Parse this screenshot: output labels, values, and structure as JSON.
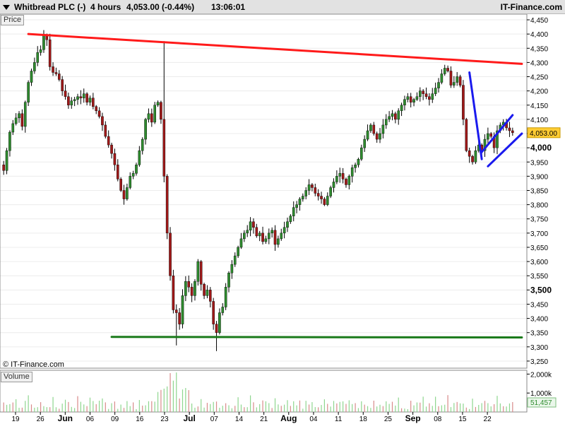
{
  "header": {
    "title": "Whitbread PLC (-)",
    "timeframe": "4 hours",
    "price_change": "4,053.00 (-0.44%)",
    "time": "13:06:01",
    "brand": "IT-Finance.com"
  },
  "panes": {
    "price_label": "Price",
    "volume_label": "Volume",
    "copyright": "© IT-Finance.com"
  },
  "colors": {
    "up_candle": "#2e8b2e",
    "down_candle": "#a01818",
    "resistance": "#ff1a1a",
    "support": "#1a7a1a",
    "channel": "#1a1aee",
    "volume_bar": "#8fd68f",
    "last_price_bg": "#ffcc33"
  },
  "chart_data": {
    "type": "candlestick",
    "title": "Whitbread PLC (-)",
    "interval": "4 hours",
    "last_price": 4053.0,
    "last_price_label": "4,053.00",
    "ylim": [
      3225,
      4470
    ],
    "y_ticks": [
      3250,
      3300,
      3350,
      3400,
      3450,
      3500,
      3550,
      3600,
      3650,
      3700,
      3750,
      3800,
      3850,
      3900,
      3950,
      4000,
      4050,
      4100,
      4150,
      4200,
      4250,
      4300,
      4350,
      4400,
      4450
    ],
    "y_tick_labels": [
      "3,250",
      "3,300",
      "3,350",
      "3,400",
      "3,450",
      "3,500",
      "3,550",
      "3,600",
      "3,650",
      "3,700",
      "3,750",
      "3,800",
      "3,850",
      "3,900",
      "3,950",
      "4,000",
      "4,050",
      "4,100",
      "4,150",
      "4,200",
      "4,250",
      "4,300",
      "4,350",
      "4,400",
      "4,450"
    ],
    "y_bold_labels": [
      "3,500",
      "4,000"
    ],
    "x_tick_labels": [
      "19",
      "26",
      "Jun",
      "06",
      "09",
      "16",
      "23",
      "Jul",
      "07",
      "14",
      "21",
      "Aug",
      "04",
      "11",
      "18",
      "25",
      "Sep",
      "08",
      "15",
      "22"
    ],
    "x_bold_labels": [
      "Jun",
      "Jul",
      "Aug",
      "Sep"
    ],
    "closes": [
      3920,
      3990,
      4055,
      4085,
      4105,
      4120,
      4075,
      4160,
      4230,
      4270,
      4300,
      4335,
      4345,
      4395,
      4380,
      4285,
      4265,
      4260,
      4240,
      4200,
      4180,
      4150,
      4165,
      4170,
      4180,
      4175,
      4190,
      4160,
      4175,
      4145,
      4130,
      4110,
      4080,
      4040,
      4010,
      3980,
      3940,
      3890,
      3850,
      3820,
      3860,
      3900,
      3910,
      3940,
      3990,
      4030,
      4100,
      4120,
      4090,
      4150,
      4160,
      4100,
      3900,
      3700,
      3550,
      3430,
      3420,
      3380,
      3480,
      3530,
      3510,
      3480,
      3530,
      3600,
      3520,
      3480,
      3500,
      3460,
      3380,
      3350,
      3420,
      3440,
      3510,
      3560,
      3590,
      3620,
      3650,
      3680,
      3700,
      3710,
      3740,
      3720,
      3690,
      3700,
      3670,
      3680,
      3700,
      3710,
      3660,
      3680,
      3700,
      3720,
      3740,
      3760,
      3790,
      3800,
      3820,
      3830,
      3850,
      3870,
      3860,
      3840,
      3830,
      3820,
      3800,
      3830,
      3860,
      3880,
      3900,
      3910,
      3890,
      3870,
      3900,
      3930,
      3940,
      3960,
      4000,
      4030,
      4060,
      4080,
      4050,
      4030,
      4050,
      4080,
      4100,
      4110,
      4120,
      4100,
      4130,
      4150,
      4170,
      4180,
      4160,
      4170,
      4180,
      4200,
      4190,
      4180,
      4170,
      4190,
      4210,
      4230,
      4260,
      4280,
      4270,
      4220,
      4230,
      4250,
      4220,
      4100,
      3990,
      3970,
      3950,
      3990,
      4010,
      3990,
      4030,
      4050,
      4040,
      4000,
      4060,
      4080,
      4090,
      4070,
      4060,
      4053
    ],
    "volume_ylim": [
      0,
      2200000
    ],
    "volume_tick_labels": [
      "2,000k",
      "1,000k"
    ],
    "volume_last_label": "51,457",
    "trendlines": [
      {
        "name": "resistance",
        "color": "resistance",
        "from": [
          8,
          4400
        ],
        "to": [
          168,
          4295
        ]
      },
      {
        "name": "support",
        "color": "support",
        "from": [
          35,
          3335
        ],
        "to": [
          168,
          3333
        ]
      },
      {
        "name": "channel-drop",
        "color": "channel",
        "from": [
          151,
          4265
        ],
        "to": [
          155,
          3960
        ]
      },
      {
        "name": "channel-lower",
        "color": "channel",
        "from": [
          157,
          3935
        ],
        "to": [
          168,
          4050
        ]
      },
      {
        "name": "channel-upper",
        "color": "channel",
        "from": [
          155,
          3985
        ],
        "to": [
          165,
          4115
        ]
      }
    ]
  }
}
